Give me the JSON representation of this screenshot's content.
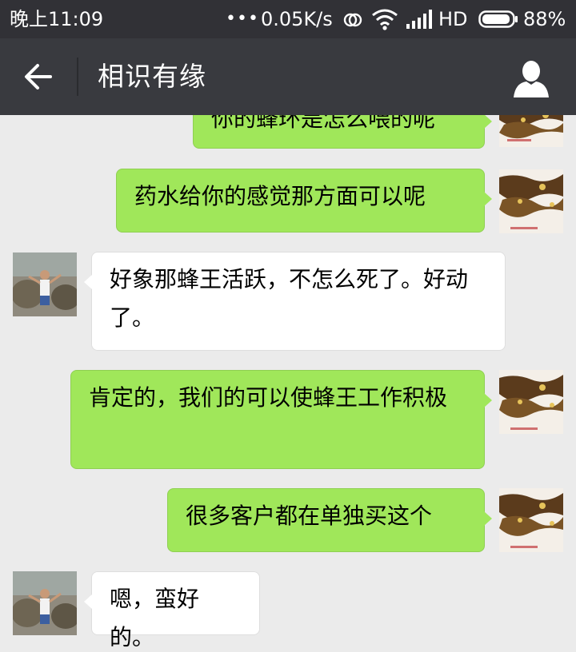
{
  "status_bar": {
    "time": "晚上11:09",
    "dots": "•••",
    "network_speed": "0.05K/s",
    "network_type": "HD",
    "battery": "88%"
  },
  "nav": {
    "title": "相识有缘",
    "back_icon": "arrow-left-icon",
    "profile_icon": "person-icon"
  },
  "colors": {
    "status_bar_bg": "#313136",
    "nav_bg": "#393a3f",
    "chat_bg": "#ebebeb",
    "sent_bubble": "#a0e75a",
    "received_bubble": "#ffffff"
  },
  "messages": [
    {
      "side": "right",
      "text": "你的蜂环是怎么喂的呢"
    },
    {
      "side": "right",
      "text": "药水给你的感觉那方面可以呢"
    },
    {
      "side": "left",
      "text": "好象那蜂王活跃，不怎么死了。好动了。"
    },
    {
      "side": "right",
      "text": "肯定的，我们的可以使蜂王工作积极"
    },
    {
      "side": "right",
      "text": "很多客户都在单独买这个"
    },
    {
      "side": "left",
      "text": "嗯，蛮好的。"
    }
  ]
}
